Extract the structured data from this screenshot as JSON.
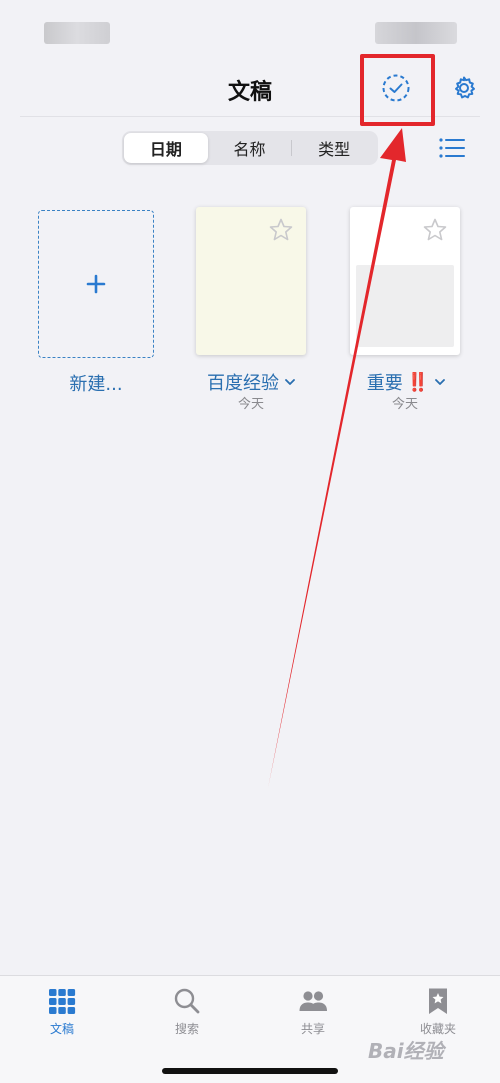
{
  "nav": {
    "title": "文稿",
    "select_icon": "checkmark-circle-dashed-icon",
    "settings_icon": "gear-icon"
  },
  "sort": {
    "options": [
      "日期",
      "名称",
      "类型"
    ],
    "selected": "日期",
    "view_icon": "list-view-icon"
  },
  "documents": {
    "new_label": "新建...",
    "items": [
      {
        "title": "百度经验",
        "date": "今天",
        "badge": ""
      },
      {
        "title": "重要",
        "date": "今天",
        "badge": "‼️"
      }
    ]
  },
  "tabs": [
    {
      "label": "文稿",
      "icon": "grid-icon",
      "active": true
    },
    {
      "label": "搜索",
      "icon": "search-icon",
      "active": false
    },
    {
      "label": "共享",
      "icon": "people-icon",
      "active": false
    },
    {
      "label": "收藏夹",
      "icon": "bookmark-star-icon",
      "active": false
    }
  ],
  "watermark": {
    "text": "Bai经验"
  },
  "colors": {
    "accent": "#2a7ad0",
    "annotation": "#e3272c",
    "background": "#f2f2f6"
  }
}
